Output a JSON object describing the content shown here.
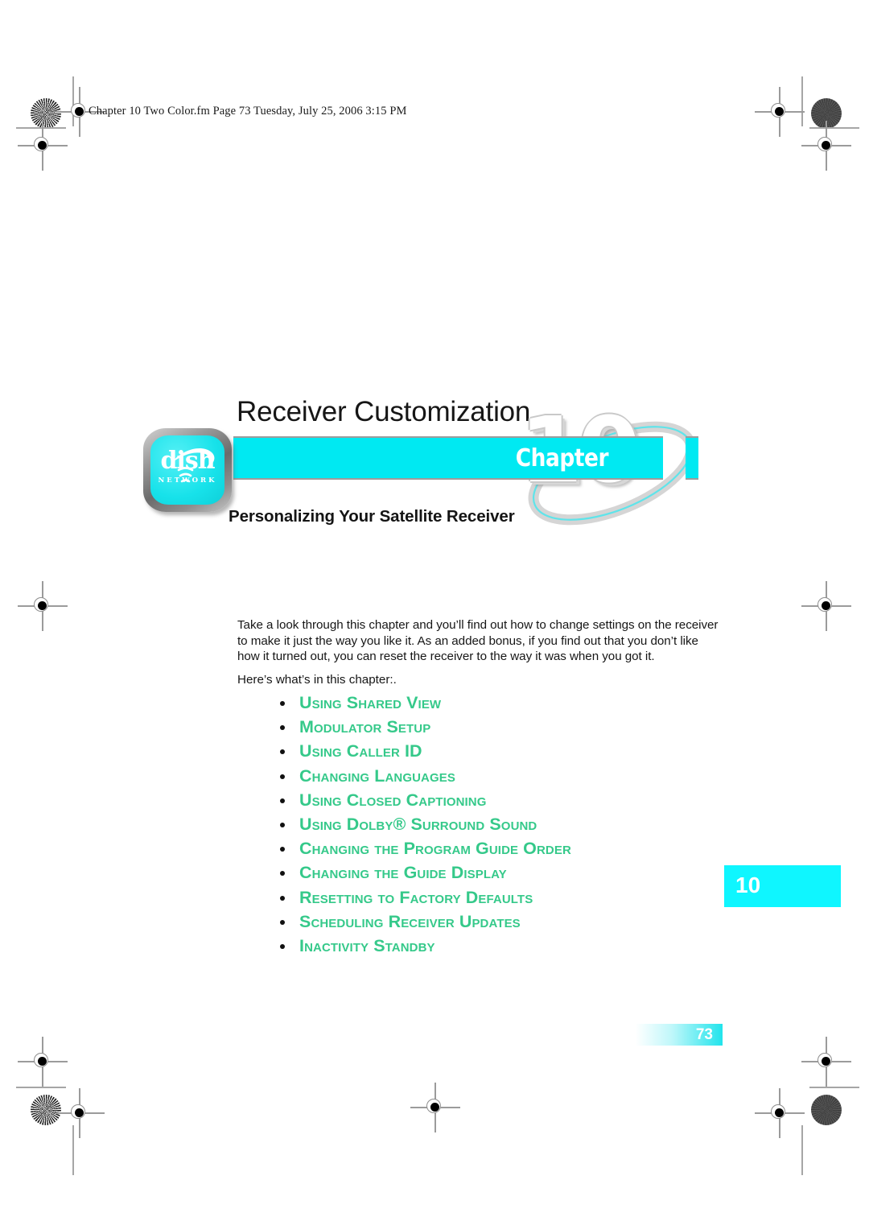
{
  "document": {
    "slug": "Chapter 10 Two Color.fm  Page 73  Tuesday, July 25, 2006  3:15 PM",
    "page_number": "73"
  },
  "banner": {
    "chapter_title": "Receiver Customization",
    "chapter_word": "Chapter",
    "chapter_number": "10",
    "subtitle": "Personalizing Your Satellite Receiver",
    "bar_color": "#00e9f2",
    "logo": {
      "brand": "dish",
      "brand_sub": "NETWORK",
      "screen_color": "#17e2ea"
    }
  },
  "body": {
    "intro": "Take a look through this chapter and you’ll find out how to change settings on the receiver to make it just the way you like it. As an added bonus, if you find out that you don’t like how it turned out, you can reset the receiver to the way it was when you got it.",
    "lead_in": "Here’s what’s in this chapter:."
  },
  "toc": {
    "accent_color": "#35c98a",
    "items": [
      "Using Shared View",
      "Modulator Setup",
      "Using Caller ID",
      "Changing Languages",
      "Using Closed Captioning",
      "Using Dolby® Surround Sound",
      "Changing the Program Guide Order",
      "Changing the Guide Display",
      "Resetting to Factory Defaults",
      "Scheduling Receiver Updates",
      "Inactivity Standby"
    ]
  },
  "side_tab": {
    "label": "10",
    "color": "#0ff6ff"
  }
}
